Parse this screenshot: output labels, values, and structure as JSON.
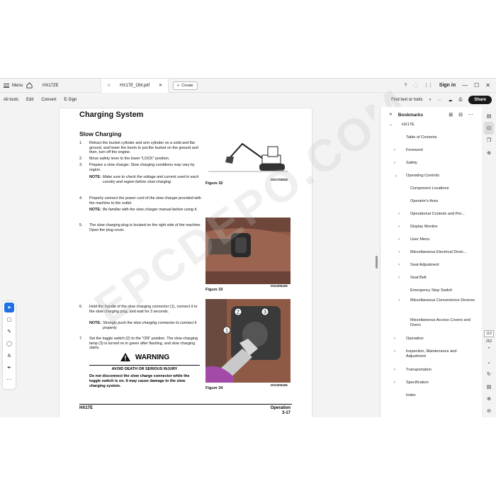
{
  "tabbar": {
    "menu_label": "Menu",
    "doc_tab_1": "HX17ZE",
    "doc_tab_2": "HX17E_OM.pdf",
    "create_label": "Create",
    "signin_label": "Sign in"
  },
  "toolbar": {
    "items": [
      "All tools",
      "Edit",
      "Convert",
      "E-Sign"
    ],
    "find_label": "Find text or tools",
    "share_label": "Share"
  },
  "page": {
    "title": "Charging System",
    "subtitle": "Slow Charging",
    "steps": [
      {
        "n": "1.",
        "text": "Retract the bucket cylinder and arm cylinder on a solid and flat ground, and lower the boom to put the bucket on the ground and then, turn off the engine."
      },
      {
        "n": "2.",
        "text": "Move safety lever to the lower \"LOCK\" position."
      },
      {
        "n": "3.",
        "text": "Prepare a slow charger. Slow charging conditions may vary by region."
      },
      {
        "n": "4.",
        "text": "Properly connect the power cord of the slow charger provided with the machine to the outlet."
      },
      {
        "n": "5.",
        "text": "The slow charging plug is located on the right side of the machine. Open the plug cover."
      },
      {
        "n": "6.",
        "text": "Hold the handle of the slow charging connector (1), connect it to the slow charging plug, and wait for 3 seconds."
      },
      {
        "n": "7.",
        "text": "Set the toggle switch (2) to the \"ON\" position. The slow charging lamp (3) is turned on in green after flashing, and slow charging starts."
      }
    ],
    "notes": [
      {
        "k": "NOTE:",
        "text": "Make sure to check the voltage and current used in each country and region before slow charging."
      },
      {
        "k": "NOTE:",
        "text": "Be familiar with the slow charger manual before using it."
      },
      {
        "k": "NOTE:",
        "text": "Strongly push the slow charging connector to connect it properly."
      }
    ],
    "figures": [
      {
        "caption": "Figure 32",
        "code": "DS1702818"
      },
      {
        "caption": "Figure 33",
        "code": "DS2300425"
      },
      {
        "caption": "Figure 34",
        "code": "DS2300426"
      }
    ],
    "callouts": [
      "1",
      "2",
      "3"
    ],
    "warning": {
      "heading": "WARNING",
      "sub": "AVOID DEATH OR SERIOUS INJURY",
      "body": "Do not disconnect the slow charge connector while the toggle switch is on. It may cause damage to the slow charging system."
    },
    "footer_left": "HX17E",
    "footer_right_1": "Operation",
    "footer_right_2": "3-17"
  },
  "bookmarks": {
    "title": "Bookmarks",
    "items": [
      {
        "label": "HX17E",
        "level": 0,
        "chev": "v"
      },
      {
        "label": "Table of Contents",
        "level": 1,
        "chev": ""
      },
      {
        "label": "Foreword",
        "level": 1,
        "chev": ">"
      },
      {
        "label": "Safety",
        "level": 1,
        "chev": ">"
      },
      {
        "label": "Operating Controls",
        "level": 1,
        "chev": "v"
      },
      {
        "label": "Component Locations",
        "level": 2,
        "chev": ""
      },
      {
        "label": "Operator's Area",
        "level": 2,
        "chev": ""
      },
      {
        "label": "Operational Controls and Per...",
        "level": 2,
        "chev": ">"
      },
      {
        "label": "Display Monitor",
        "level": 2,
        "chev": ">"
      },
      {
        "label": "User Menu",
        "level": 2,
        "chev": ">"
      },
      {
        "label": "Miscellaneous Electrical Devic...",
        "level": 2,
        "chev": ">"
      },
      {
        "label": "Seat Adjustment",
        "level": 2,
        "chev": ">"
      },
      {
        "label": "Seat Belt",
        "level": 2,
        "chev": ">"
      },
      {
        "label": "Emergency Stop Switch",
        "level": 2,
        "chev": ""
      },
      {
        "label": "Miscellaneous Convenience Devices",
        "level": 2,
        "chev": ">"
      },
      {
        "label": "Miscellaneous Access Covers and Doors",
        "level": 2,
        "chev": ""
      },
      {
        "label": "Operation",
        "level": 1,
        "chev": ">"
      },
      {
        "label": "Inspection, Maintenance and Adjustment",
        "level": 1,
        "chev": ">"
      },
      {
        "label": "Transportation",
        "level": 1,
        "chev": ">"
      },
      {
        "label": "Specification",
        "level": 1,
        "chev": ">"
      },
      {
        "label": "Index",
        "level": 1,
        "chev": ""
      }
    ]
  },
  "rail": {
    "current_page": "119",
    "total_pages": "252"
  },
  "watermark": "EPCDEPO.COM"
}
